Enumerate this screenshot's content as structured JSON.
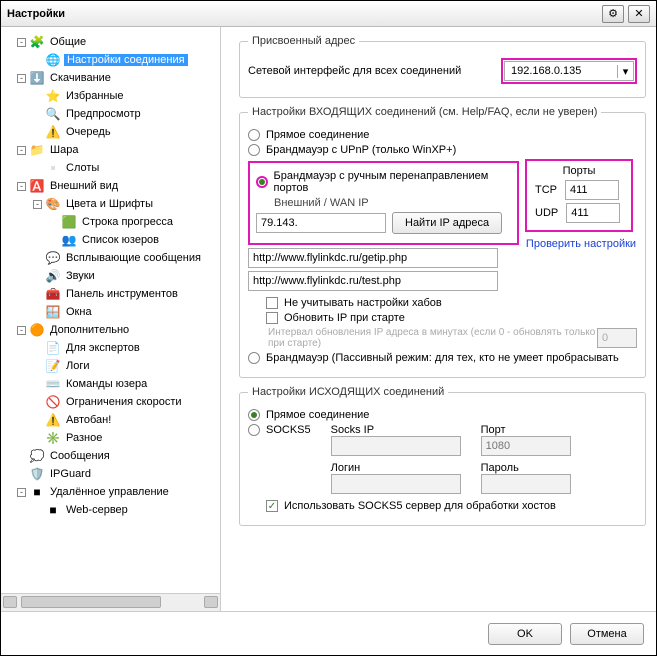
{
  "window": {
    "title": "Настройки"
  },
  "tree": [
    {
      "indent": 0,
      "twisty": "-",
      "icon": "🧩",
      "label": "Общие"
    },
    {
      "indent": 1,
      "twisty": "",
      "icon": "🌐",
      "label": "Настройки соединения",
      "selected": true
    },
    {
      "indent": 0,
      "twisty": "-",
      "icon": "⬇️",
      "label": "Скачивание"
    },
    {
      "indent": 1,
      "twisty": "",
      "icon": "⭐",
      "label": "Избранные"
    },
    {
      "indent": 1,
      "twisty": "",
      "icon": "🔍",
      "label": "Предпросмотр"
    },
    {
      "indent": 1,
      "twisty": "",
      "icon": "⚠️",
      "label": "Очередь"
    },
    {
      "indent": 0,
      "twisty": "-",
      "icon": "📁",
      "label": "Шара"
    },
    {
      "indent": 1,
      "twisty": "",
      "icon": "▫️",
      "label": "Слоты"
    },
    {
      "indent": 0,
      "twisty": "-",
      "icon": "🅰️",
      "label": "Внешний вид"
    },
    {
      "indent": 1,
      "twisty": "-",
      "icon": "🎨",
      "label": "Цвета и Шрифты"
    },
    {
      "indent": 2,
      "twisty": "",
      "icon": "🟩",
      "label": "Строка прогресса"
    },
    {
      "indent": 2,
      "twisty": "",
      "icon": "👥",
      "label": "Список юзеров"
    },
    {
      "indent": 1,
      "twisty": "",
      "icon": "💬",
      "label": "Всплывающие сообщения"
    },
    {
      "indent": 1,
      "twisty": "",
      "icon": "🔊",
      "label": "Звуки"
    },
    {
      "indent": 1,
      "twisty": "",
      "icon": "🧰",
      "label": "Панель инструментов"
    },
    {
      "indent": 1,
      "twisty": "",
      "icon": "🪟",
      "label": "Окна"
    },
    {
      "indent": 0,
      "twisty": "-",
      "icon": "🟠",
      "label": "Дополнительно"
    },
    {
      "indent": 1,
      "twisty": "",
      "icon": "📄",
      "label": "Для экспертов"
    },
    {
      "indent": 1,
      "twisty": "",
      "icon": "📝",
      "label": "Логи"
    },
    {
      "indent": 1,
      "twisty": "",
      "icon": "⌨️",
      "label": "Команды юзера"
    },
    {
      "indent": 1,
      "twisty": "",
      "icon": "🚫",
      "label": "Ограничения скорости"
    },
    {
      "indent": 1,
      "twisty": "",
      "icon": "⚠️",
      "label": "Автобан!"
    },
    {
      "indent": 1,
      "twisty": "",
      "icon": "✳️",
      "label": "Разное"
    },
    {
      "indent": 0,
      "twisty": "",
      "icon": "💭",
      "label": "Сообщения"
    },
    {
      "indent": 0,
      "twisty": "",
      "icon": "🛡️",
      "label": "IPGuard"
    },
    {
      "indent": 0,
      "twisty": "-",
      "icon": "■",
      "label": "Удалённое управление"
    },
    {
      "indent": 1,
      "twisty": "",
      "icon": "■",
      "label": "Web-сервер"
    }
  ],
  "assigned": {
    "legend": "Присвоенный адрес",
    "iface_label": "Сетевой интерфейс для всех соединений",
    "iface_value": "192.168.0.135"
  },
  "incoming": {
    "legend": "Настройки ВХОДЯЩИХ соединений (см. Help/FAQ, если не уверен)",
    "direct": "Прямое соединение",
    "upnp": "Брандмауэр с UPnP (только WinXP+)",
    "manual": "Брандмауэр с ручным перенаправлением портов",
    "wan_label": "Внешний / WAN IP",
    "wan_ip": "79.143.",
    "find_ip_btn": "Найти IP адреса",
    "getip_url": "http://www.flylinkdc.ru/getip.php",
    "test_url": "http://www.flylinkdc.ru/test.php",
    "no_hub_override": "Не учитывать настройки хабов",
    "update_on_start": "Обновить IP при старте",
    "interval_note": "Интервал обновления IP адреса в минутах (если 0 - обновлять только при старте)",
    "interval_value": "0",
    "passive": "Брандмауэр (Пассивный режим: для тех, кто не умеет пробрасывать",
    "ports_title": "Порты",
    "tcp_label": "TCP",
    "tcp_value": "411",
    "udp_label": "UDP",
    "udp_value": "411",
    "check_link": "Проверить настройки"
  },
  "outgoing": {
    "legend": "Настройки ИСХОДЯЩИХ соединений",
    "direct": "Прямое соединение",
    "socks5": "SOCKS5",
    "ip_label": "Socks IP",
    "port_label": "Порт",
    "port_placeholder": "1080",
    "login_label": "Логин",
    "pass_label": "Пароль",
    "use_socks_resolve": "Использовать SOCKS5 сервер для обработки хостов"
  },
  "footer": {
    "ok": "OK",
    "cancel": "Отмена"
  }
}
